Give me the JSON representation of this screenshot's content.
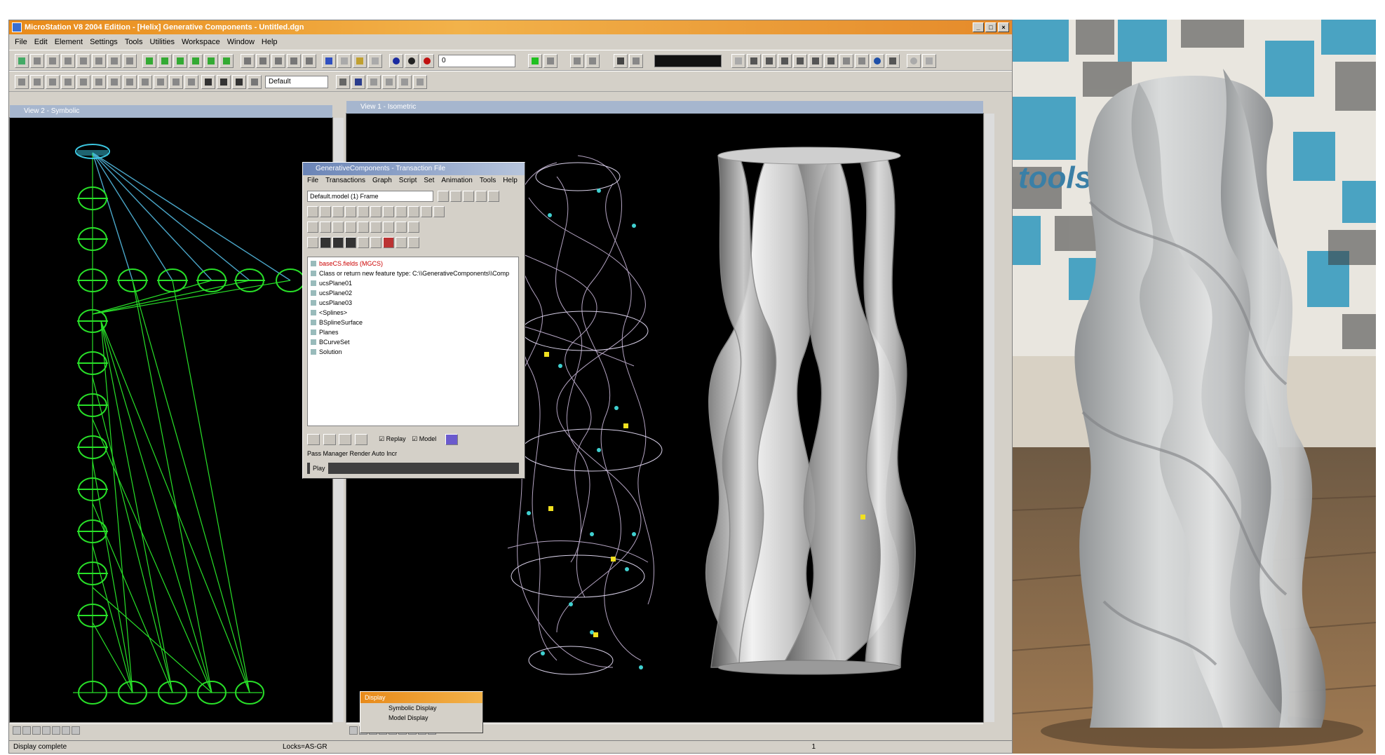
{
  "window": {
    "title": "MicroStation V8 2004 Edition - [Helix] Generative Components - Untitled.dgn"
  },
  "menu": [
    "File",
    "Edit",
    "Element",
    "Settings",
    "Tools",
    "Utilities",
    "Workspace",
    "Window",
    "Help"
  ],
  "toolbar": {
    "level_field": "Default",
    "command_field": "0"
  },
  "views": {
    "left": {
      "title": "View 2 - Symbolic"
    },
    "center": {
      "title": "View 1 - Isometric"
    }
  },
  "gc_dialog": {
    "title": "GenerativeComponents - Transaction File",
    "menu": [
      "File",
      "Transactions",
      "Graph",
      "Script",
      "Set",
      "Animation",
      "Tools",
      "Help"
    ],
    "combo_value": "Default.model (1) Frame",
    "tree_items": [
      "baseCS.fields (MGCS)",
      "Class or return new feature type: C:\\\\GenerativeComponents\\\\Comp",
      "ucsPlane01",
      "ucsPlane02",
      "ucsPlane03",
      "<Splines>",
      "BSplineSurface",
      "Planes",
      "BCurveSet",
      "Solution"
    ],
    "replay_label": "Replay",
    "model_label": "Model",
    "opts_text": "Pass Manager  Render  Auto Incr",
    "play_label": "Play"
  },
  "mini_dialog": {
    "title": "Display",
    "option1": "Symbolic Display",
    "option2": "Model Display"
  },
  "status": {
    "left": "Display complete",
    "mid": "Locks=AS-GR",
    "right": "1"
  },
  "photo": {
    "wall_text": "tools"
  }
}
